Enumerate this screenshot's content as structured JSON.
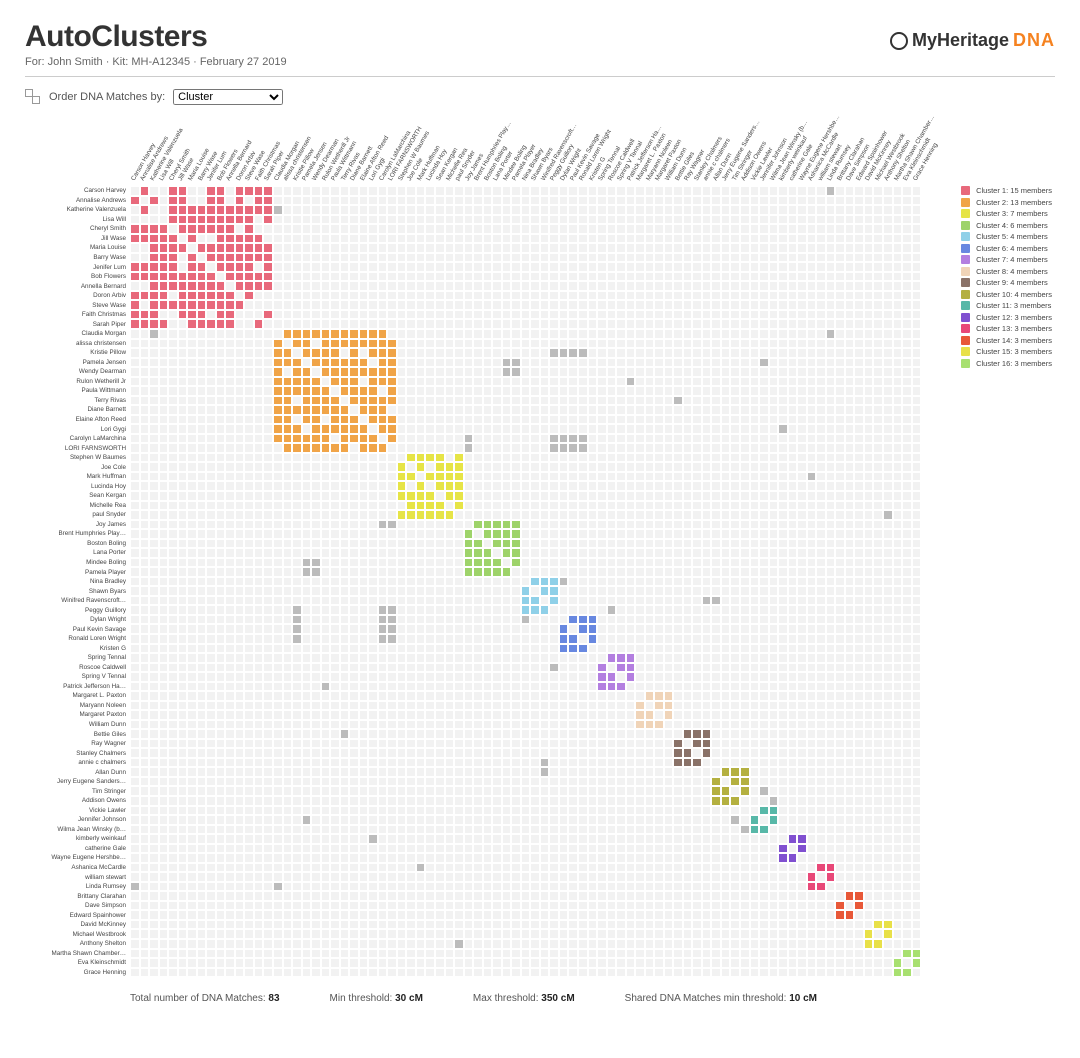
{
  "header": {
    "title": "AutoClusters",
    "subtitle": "For: John Smith · Kit: MH-A12345 · February 27 2019",
    "brand_text": "MyHeritage",
    "brand_dna": "DNA"
  },
  "controls": {
    "order_label": "Order DNA Matches by:",
    "order_selected": "Cluster",
    "order_options": [
      "Cluster"
    ]
  },
  "footer": {
    "total_label": "Total number of DNA Matches:",
    "total_value": "83",
    "min_label": "Min threshold:",
    "min_value": "30 cM",
    "max_label": "Max threshold:",
    "max_value": "350 cM",
    "shared_label": "Shared DNA Matches min threshold:",
    "shared_value": "10 cM"
  },
  "legend": [
    {
      "label": "Cluster 1: 15 members",
      "color": "#e8697b"
    },
    {
      "label": "Cluster 2: 13 members",
      "color": "#f0a448"
    },
    {
      "label": "Cluster 3: 7 members",
      "color": "#e6e446"
    },
    {
      "label": "Cluster 4: 6 members",
      "color": "#9ed36a"
    },
    {
      "label": "Cluster 5: 4 members",
      "color": "#8fd0e8"
    },
    {
      "label": "Cluster 6: 4 members",
      "color": "#6888e0"
    },
    {
      "label": "Cluster 7: 4 members",
      "color": "#b37fe0"
    },
    {
      "label": "Cluster 8: 4 members",
      "color": "#f0d4b8"
    },
    {
      "label": "Cluster 9: 4 members",
      "color": "#8a7268"
    },
    {
      "label": "Cluster 10: 4 members",
      "color": "#b4b040"
    },
    {
      "label": "Cluster 11: 3 members",
      "color": "#58b8a8"
    },
    {
      "label": "Cluster 12: 3 members",
      "color": "#8050d0"
    },
    {
      "label": "Cluster 13: 3 members",
      "color": "#e84878"
    },
    {
      "label": "Cluster 14: 3 members",
      "color": "#e85838"
    },
    {
      "label": "Cluster 15: 3 members",
      "color": "#e8e048"
    },
    {
      "label": "Cluster 16: 3 members",
      "color": "#a8e070"
    }
  ],
  "chart_data": {
    "type": "heatmap",
    "title": "AutoClusters matrix",
    "members": [
      {
        "name": "Carson Harvey",
        "cluster": 1
      },
      {
        "name": "Annalise Andrews",
        "cluster": 1
      },
      {
        "name": "Katherine Valenzuela",
        "cluster": 1
      },
      {
        "name": "Lisa Will",
        "cluster": 1
      },
      {
        "name": "Cheryl Smith",
        "cluster": 1
      },
      {
        "name": "Jill Wase",
        "cluster": 1
      },
      {
        "name": "Maria Louise",
        "cluster": 1
      },
      {
        "name": "Barry Wase",
        "cluster": 1
      },
      {
        "name": "Jenifer Lum",
        "cluster": 1
      },
      {
        "name": "Bob Flowers",
        "cluster": 1
      },
      {
        "name": "Annella Bernard",
        "cluster": 1
      },
      {
        "name": "Doron Arbiv",
        "cluster": 1
      },
      {
        "name": "Steve Wase",
        "cluster": 1
      },
      {
        "name": "Faith Christmas",
        "cluster": 1
      },
      {
        "name": "Sarah Piper",
        "cluster": 1
      },
      {
        "name": "Claudia Morgan",
        "cluster": 2
      },
      {
        "name": "alissa christensen",
        "cluster": 2
      },
      {
        "name": "Kristie Pillow",
        "cluster": 2
      },
      {
        "name": "Pamela Jensen",
        "cluster": 2
      },
      {
        "name": "Wendy Dearman",
        "cluster": 2
      },
      {
        "name": "Rulon Wetherill Jr",
        "cluster": 2
      },
      {
        "name": "Paula Wittmann",
        "cluster": 2
      },
      {
        "name": "Terry Rivas",
        "cluster": 2
      },
      {
        "name": "Diane Barnett",
        "cluster": 2
      },
      {
        "name": "Elaine Afton Reed",
        "cluster": 2
      },
      {
        "name": "Lori Gygi",
        "cluster": 2
      },
      {
        "name": "Carolyn LaMarchina",
        "cluster": 2
      },
      {
        "name": "LORI FARNSWORTH",
        "cluster": 2
      },
      {
        "name": "Stephen W Baumes",
        "cluster": 3
      },
      {
        "name": "Joe Cole",
        "cluster": 3
      },
      {
        "name": "Mark Huffman",
        "cluster": 3
      },
      {
        "name": "Lucinda Hoy",
        "cluster": 3
      },
      {
        "name": "Sean Kergan",
        "cluster": 3
      },
      {
        "name": "Michelle Rea",
        "cluster": 3
      },
      {
        "name": "paul Snyder",
        "cluster": 3
      },
      {
        "name": "Joy James",
        "cluster": 4
      },
      {
        "name": "Brent Humphries Play…",
        "cluster": 4
      },
      {
        "name": "Boston Boling",
        "cluster": 4
      },
      {
        "name": "Lana Porter",
        "cluster": 4
      },
      {
        "name": "Mindee Boling",
        "cluster": 4
      },
      {
        "name": "Pamela Player",
        "cluster": 4
      },
      {
        "name": "Nina Bradley",
        "cluster": 5
      },
      {
        "name": "Shawn Byars",
        "cluster": 5
      },
      {
        "name": "Winifred Ravenscroft…",
        "cluster": 5
      },
      {
        "name": "Peggy Guillory",
        "cluster": 5
      },
      {
        "name": "Dylan Wright",
        "cluster": 6
      },
      {
        "name": "Paul Kevin Savage",
        "cluster": 6
      },
      {
        "name": "Ronald Loren Wright",
        "cluster": 6
      },
      {
        "name": "Kristen G",
        "cluster": 6
      },
      {
        "name": "Spring Tennal",
        "cluster": 7
      },
      {
        "name": "Roscoe Caldwell",
        "cluster": 7
      },
      {
        "name": "Spring V Tennal",
        "cluster": 7
      },
      {
        "name": "Patrick Jefferson Ha…",
        "cluster": 7
      },
      {
        "name": "Margaret L. Paxton",
        "cluster": 8
      },
      {
        "name": "Maryann Noleen",
        "cluster": 8
      },
      {
        "name": "Margaret Paxton",
        "cluster": 8
      },
      {
        "name": "William Dunn",
        "cluster": 8
      },
      {
        "name": "Bettie Giles",
        "cluster": 9
      },
      {
        "name": "Ray Wagner",
        "cluster": 9
      },
      {
        "name": "Stanley Chalmers",
        "cluster": 9
      },
      {
        "name": "annie c chalmers",
        "cluster": 9
      },
      {
        "name": "Allan Dunn",
        "cluster": 10
      },
      {
        "name": "Jerry Eugene Sanders…",
        "cluster": 10
      },
      {
        "name": "Tim Stringer",
        "cluster": 10
      },
      {
        "name": "Addison Owens",
        "cluster": 10
      },
      {
        "name": "Vickie Lawler",
        "cluster": 11
      },
      {
        "name": "Jennifer Johnson",
        "cluster": 11
      },
      {
        "name": "Wilma Jean Winsky (b…",
        "cluster": 11
      },
      {
        "name": "kimberly weinkauf",
        "cluster": 12
      },
      {
        "name": "catherine Gale",
        "cluster": 12
      },
      {
        "name": "Wayne Eugene Hershbe…",
        "cluster": 12
      },
      {
        "name": "Ashanica McCardle",
        "cluster": 13
      },
      {
        "name": "william stewart",
        "cluster": 13
      },
      {
        "name": "Linda Rumsey",
        "cluster": 13
      },
      {
        "name": "Brittany Clarahan",
        "cluster": 14
      },
      {
        "name": "Dave Simpson",
        "cluster": 14
      },
      {
        "name": "Edward Spainhower",
        "cluster": 14
      },
      {
        "name": "David McKinney",
        "cluster": 15
      },
      {
        "name": "Michael Westbrook",
        "cluster": 15
      },
      {
        "name": "Anthony Shelton",
        "cluster": 15
      },
      {
        "name": "Martha Shawn Chamber…",
        "cluster": 16
      },
      {
        "name": "Eva Kleinschmidt",
        "cluster": 16
      },
      {
        "name": "Grace Henning",
        "cluster": 16
      }
    ],
    "grey_links": [
      [
        0,
        73
      ],
      [
        15,
        2
      ],
      [
        15,
        73
      ],
      [
        17,
        45
      ],
      [
        17,
        46
      ],
      [
        18,
        40
      ],
      [
        18,
        66
      ],
      [
        19,
        40
      ],
      [
        22,
        57
      ],
      [
        25,
        68
      ],
      [
        26,
        45
      ],
      [
        26,
        46
      ],
      [
        27,
        45
      ],
      [
        27,
        46
      ],
      [
        30,
        71
      ],
      [
        34,
        79
      ],
      [
        35,
        26
      ],
      [
        35,
        27
      ],
      [
        39,
        18
      ],
      [
        39,
        19
      ],
      [
        41,
        44
      ],
      [
        41,
        45
      ],
      [
        43,
        60
      ],
      [
        43,
        61
      ],
      [
        44,
        17
      ],
      [
        44,
        26
      ],
      [
        44,
        27
      ],
      [
        44,
        41
      ],
      [
        44,
        50
      ],
      [
        45,
        17
      ],
      [
        45,
        26
      ],
      [
        45,
        27
      ],
      [
        45,
        41
      ],
      [
        46,
        26
      ],
      [
        46,
        27
      ],
      [
        47,
        26
      ],
      [
        47,
        27
      ],
      [
        50,
        44
      ],
      [
        52,
        20
      ],
      [
        57,
        22
      ],
      [
        60,
        43
      ],
      [
        61,
        43
      ],
      [
        63,
        66
      ],
      [
        64,
        67
      ],
      [
        66,
        18
      ],
      [
        66,
        63
      ],
      [
        67,
        64
      ],
      [
        68,
        25
      ],
      [
        71,
        30
      ],
      [
        73,
        0
      ],
      [
        73,
        15
      ],
      [
        79,
        34
      ],
      [
        2,
        15
      ],
      [
        20,
        52
      ],
      [
        46,
        17
      ],
      [
        17,
        47
      ]
    ],
    "cluster_holes": {
      "1": [
        [
          0,
          2
        ],
        [
          0,
          3
        ],
        [
          0,
          6
        ],
        [
          0,
          7
        ],
        [
          0,
          10
        ],
        [
          1,
          3
        ],
        [
          1,
          6
        ],
        [
          1,
          7
        ],
        [
          1,
          10
        ],
        [
          1,
          12
        ],
        [
          2,
          0
        ],
        [
          3,
          0
        ],
        [
          3,
          1
        ],
        [
          3,
          13
        ],
        [
          4,
          11
        ],
        [
          4,
          13
        ],
        [
          4,
          14
        ],
        [
          5,
          7
        ],
        [
          5,
          8
        ],
        [
          5,
          14
        ],
        [
          6,
          0
        ],
        [
          6,
          1
        ],
        [
          7,
          0
        ],
        [
          7,
          1
        ],
        [
          7,
          5
        ],
        [
          8,
          5
        ],
        [
          8,
          13
        ],
        [
          10,
          0
        ],
        [
          10,
          1
        ],
        [
          11,
          4
        ],
        [
          11,
          13
        ],
        [
          11,
          14
        ],
        [
          12,
          1
        ],
        [
          12,
          13
        ],
        [
          12,
          14
        ],
        [
          13,
          3
        ],
        [
          13,
          4
        ],
        [
          13,
          8
        ],
        [
          13,
          11
        ],
        [
          13,
          12
        ],
        [
          14,
          4
        ],
        [
          14,
          5
        ],
        [
          14,
          11
        ],
        [
          14,
          12
        ],
        [
          2,
          3
        ],
        [
          3,
          2
        ]
      ],
      "2": [
        [
          0,
          12
        ],
        [
          1,
          4
        ],
        [
          2,
          7
        ],
        [
          3,
          10
        ],
        [
          4,
          1
        ],
        [
          5,
          9
        ],
        [
          6,
          11
        ],
        [
          7,
          2
        ],
        [
          8,
          12
        ],
        [
          9,
          5
        ],
        [
          10,
          3
        ],
        [
          11,
          6
        ],
        [
          12,
          0
        ],
        [
          12,
          8
        ],
        [
          2,
          9
        ],
        [
          9,
          2
        ]
      ],
      "3": [
        [
          0,
          5
        ],
        [
          5,
          0
        ],
        [
          1,
          3
        ],
        [
          3,
          1
        ]
      ]
    }
  }
}
